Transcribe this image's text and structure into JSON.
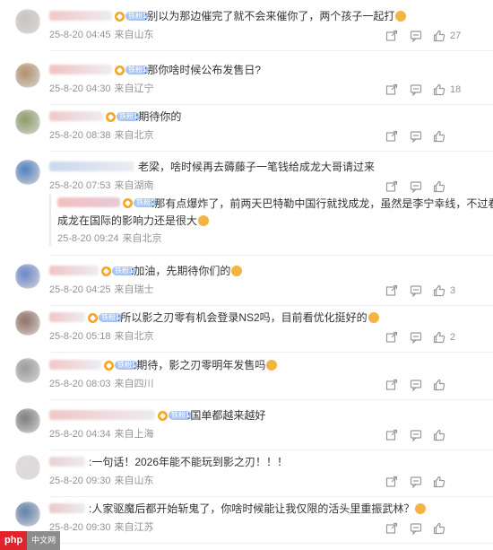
{
  "comments": [
    {
      "text": ":别以为那边催完了就不会来催你了，两个孩子一起打",
      "date": "25-8-20 04:45",
      "location": "来自山东",
      "likes": "27",
      "avatar_color": "#c9c4c2"
    },
    {
      "text": ":那你啥时候公布发售日?",
      "date": "25-8-20 04:30",
      "location": "来自辽宁",
      "likes": "18",
      "avatar_color": "#b38e6a"
    },
    {
      "text": ":期待你的",
      "date": "25-8-20 08:38",
      "location": "来自北京",
      "likes": "",
      "avatar_color": "#8d9a66"
    },
    {
      "text": "老梁，啥时候再去薅藤子一笔钱给成龙大哥请过来",
      "date": "25-8-20 07:53",
      "location": "来自湖南",
      "likes": "",
      "avatar_color": "#4f7fc0"
    },
    {
      "text": ":加油，先期待你们的",
      "date": "25-8-20 04:25",
      "location": "来自瑞士",
      "likes": "3",
      "avatar_color": "#6a85c9"
    },
    {
      "text": ":所以影之刃零有机会登录NS2吗，目前看优化挺好的",
      "date": "25-8-20 05:18",
      "location": "来自北京",
      "likes": "2",
      "avatar_color": "#8f6e62"
    },
    {
      "text": ":期待，影之刃零明年发售吗",
      "date": "25-8-20 08:03",
      "location": "来自四川",
      "likes": "",
      "avatar_color": "#9a9a9a"
    },
    {
      "text": ":国单都越来越好",
      "date": "25-8-20 04:34",
      "location": "来自上海",
      "likes": "",
      "avatar_color": "#7c7c7c"
    },
    {
      "text": ":一句话！2026年能不能玩到影之刃！！！",
      "date": "25-8-20 09:30",
      "location": "来自山东",
      "likes": "",
      "avatar_color": "#e2dcdc"
    },
    {
      "text": ":人家驱魔后都开始斩鬼了，你啥时候能让我仅限的活头里重振武林？",
      "date": "25-8-20 09:30",
      "location": "来自江苏",
      "likes": "",
      "avatar_color": "#5d7fa8"
    }
  ],
  "reply": {
    "line1": ":那有点爆炸了，前两天巴特勒中国行就找成龙，虽然是李宁幸线，不过看来",
    "line2": "成龙在国际的影响力还是很大",
    "date": "25-8-20 09:24",
    "location": "来自北京"
  },
  "fan_badge": "铁粉1",
  "watermark": {
    "logo": "php",
    "site": "中文网"
  },
  "colors": {
    "meta": "#939393",
    "text": "#333333",
    "fan_heart": "#f6a623",
    "fan_level": "#a8c4f0"
  }
}
